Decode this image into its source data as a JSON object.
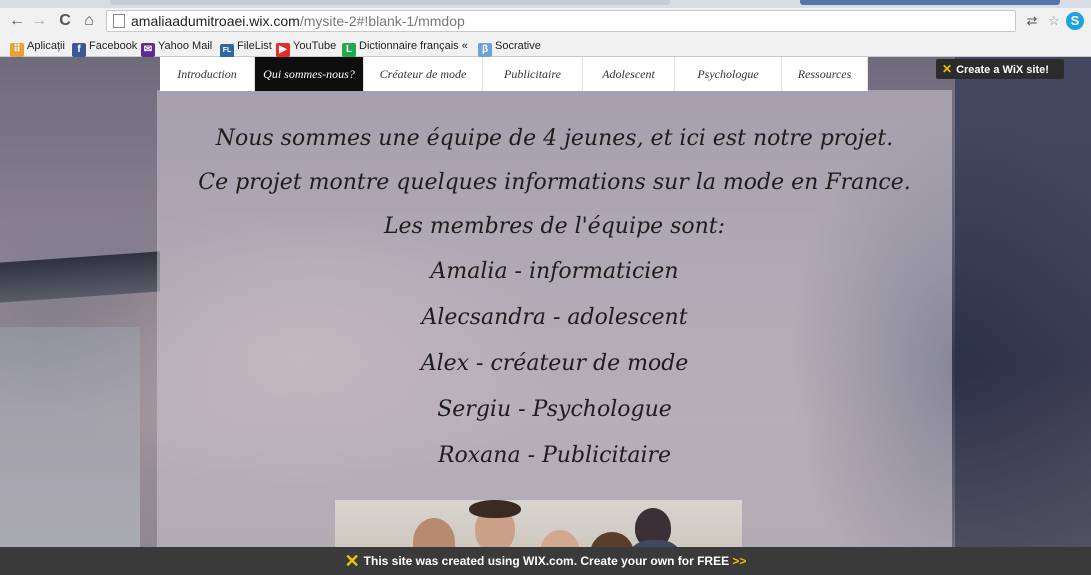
{
  "browser": {
    "url_host": "amaliaadumitroaei.wix.com",
    "url_path": "/mysite-2#!blank-1/mmdop",
    "nav": {
      "back": "←",
      "forward": "→",
      "reload": "C",
      "home": "⌂"
    }
  },
  "bookmarks": [
    {
      "label": "Aplicații",
      "icon": "apps-grid-icon",
      "color": "#e8a23a"
    },
    {
      "label": "Facebook",
      "icon": "facebook-icon",
      "color": "#3b5998"
    },
    {
      "label": "Yahoo Mail",
      "icon": "yahoo-mail-icon",
      "color": "#5c2d91"
    },
    {
      "label": "FileList",
      "icon": "filelist-icon",
      "color": "#2a6aa0"
    },
    {
      "label": "YouTube",
      "icon": "youtube-icon",
      "color": "#e52d27"
    },
    {
      "label": "Dictionnaire français «",
      "icon": "dictionary-icon",
      "color": "#22a94e"
    },
    {
      "label": "Socrative",
      "icon": "socrative-icon",
      "color": "#6fa0d8"
    }
  ],
  "create_site_button": "Create a WiX site!",
  "menu": [
    "Introduction",
    "Qui sommes-nous?",
    "Créateur de mode",
    "Publicitaire",
    "Adolescent",
    "Psychologue",
    "Ressources"
  ],
  "intro_lines": [
    "Nous sommes une équipe de 4 jeunes, et ici est notre projet.",
    "Ce projet montre quelques informations sur la mode en France.",
    "Les membres de l'équipe sont:"
  ],
  "members": [
    "Amalia - informaticien",
    "Alecsandra - adolescent",
    "Alex - créateur de mode",
    "Sergiu - Psychologue",
    "Roxana - Publicitaire"
  ],
  "footer": {
    "text": "This site was created using WIX.com. Create your own for FREE",
    "arrows": ">>"
  },
  "colors": {
    "menu_active": "#0e0e0e",
    "wix_yellow": "#f2c200",
    "footer_bg": "#3a3a3a"
  }
}
